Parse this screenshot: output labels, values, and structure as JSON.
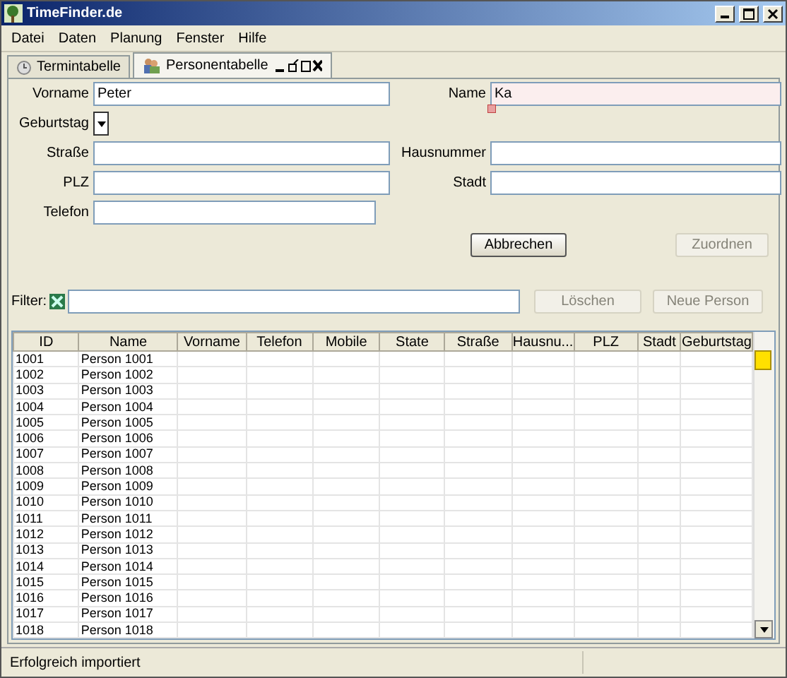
{
  "window": {
    "title": "TimeFinder.de"
  },
  "menu": [
    "Datei",
    "Daten",
    "Planung",
    "Fenster",
    "Hilfe"
  ],
  "tabs": [
    {
      "label": "Termintabelle",
      "selected": false
    },
    {
      "label": "Personentabelle",
      "selected": true
    }
  ],
  "form": {
    "fields": [
      {
        "label": "Vorname",
        "value": "Peter",
        "invalid": false
      },
      {
        "label": "Name",
        "value": "Ka",
        "invalid": true
      },
      {
        "label": "Straße",
        "invalid": false
      },
      {
        "label": "Hausnummer",
        "invalid": false
      },
      {
        "label": "PLZ",
        "invalid": false
      },
      {
        "label": "Stadt",
        "invalid": false
      }
    ],
    "birthday_label": "Geburtstag",
    "phone": {
      "label": "Telefon"
    },
    "buttons": [
      {
        "label": "Abbrechen",
        "disabled": false
      },
      {
        "label": "Zuordnen",
        "disabled": true
      }
    ]
  },
  "filter": {
    "label": "Filter:",
    "buttons": [
      {
        "label": "Löschen",
        "disabled": true
      },
      {
        "label": "Neue Person",
        "disabled": true
      }
    ]
  },
  "table": {
    "columns": [
      "ID",
      "Name",
      "Vorname",
      "Telefon",
      "Mobile",
      "State",
      "Straße",
      "Hausnu...",
      "PLZ",
      "Stadt",
      "Geburtstag"
    ],
    "rows": [
      [
        "1001",
        "Person 1001"
      ],
      [
        "1002",
        "Person 1002"
      ],
      [
        "1003",
        "Person 1003"
      ],
      [
        "1004",
        "Person 1004"
      ],
      [
        "1005",
        "Person 1005"
      ],
      [
        "1006",
        "Person 1006"
      ],
      [
        "1007",
        "Person 1007"
      ],
      [
        "1008",
        "Person 1008"
      ],
      [
        "1009",
        "Person 1009"
      ],
      [
        "1010",
        "Person 1010"
      ],
      [
        "1011",
        "Person 1011"
      ],
      [
        "1012",
        "Person 1012"
      ],
      [
        "1013",
        "Person 1013"
      ],
      [
        "1014",
        "Person 1014"
      ],
      [
        "1015",
        "Person 1015"
      ],
      [
        "1016",
        "Person 1016"
      ],
      [
        "1017",
        "Person 1017"
      ],
      [
        "1018",
        "Person 1018"
      ]
    ]
  },
  "status_bar": "Erfolgreich importiert"
}
